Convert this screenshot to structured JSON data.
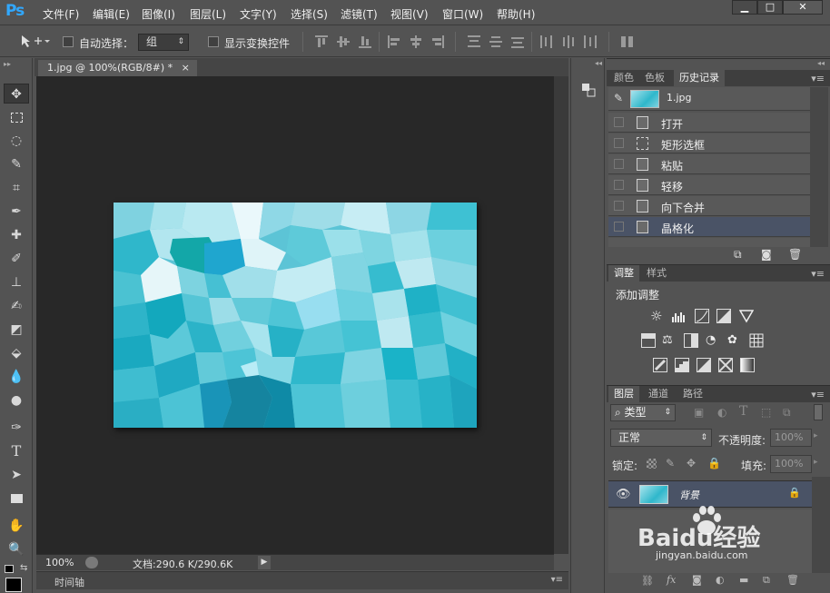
{
  "app": {
    "logo": "Ps"
  },
  "menu": [
    "文件(F)",
    "编辑(E)",
    "图像(I)",
    "图层(L)",
    "文字(Y)",
    "选择(S)",
    "滤镜(T)",
    "视图(V)",
    "窗口(W)",
    "帮助(H)"
  ],
  "window_buttons": {
    "minimize": "▁",
    "restore": "□",
    "close": "✕"
  },
  "options": {
    "auto_select_label": "自动选择：",
    "auto_select_value": "组",
    "show_transform_label": "显示变换控件"
  },
  "document": {
    "tab_title": "1.jpg @ 100%(RGB/8#) *",
    "tab_close": "×",
    "zoom": "100%",
    "doc_info": "文档:290.6 K/290.6K"
  },
  "timeline": {
    "label": "时间轴"
  },
  "history_panel": {
    "tabs": [
      "颜色",
      "色板",
      "历史记录"
    ],
    "active_tab": "历史记录",
    "snapshot_label": "1.jpg",
    "items": [
      "打开",
      "矩形选框",
      "粘贴",
      "轻移",
      "向下合并",
      "晶格化"
    ],
    "selected": "晶格化"
  },
  "adjustments_panel": {
    "tabs": [
      "调整",
      "样式"
    ],
    "active_tab": "调整",
    "title": "添加调整"
  },
  "layers_panel": {
    "tabs": [
      "图层",
      "通道",
      "路径"
    ],
    "active_tab": "图层",
    "filter_kind": "类型",
    "blend_mode": "正常",
    "opacity_label": "不透明度:",
    "opacity_value": "100%",
    "lock_label": "锁定:",
    "fill_label": "填充:",
    "fill_value": "100%",
    "layers": [
      {
        "name": "背景",
        "visible": true,
        "locked": true
      }
    ]
  },
  "watermark": {
    "brand": "Baidu经验",
    "url": "jingyan.baidu.com"
  },
  "colors": {
    "panel_bg": "#535353",
    "canvas_bg": "#282828",
    "selection": "#4a5366",
    "ps_blue": "#31a8ff"
  }
}
